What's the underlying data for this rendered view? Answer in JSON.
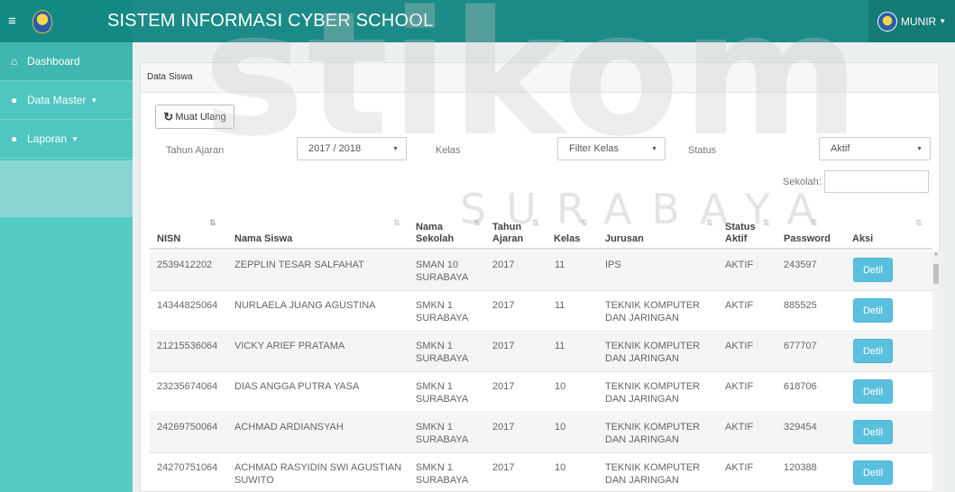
{
  "header": {
    "menu_icon": "hamburger-icon",
    "logo_icon": "crest-logo-icon",
    "title": "SISTEM INFORMASI CYBER SCHOOL",
    "user": "MUNIR"
  },
  "sidebar": {
    "items": [
      {
        "label": "Dashboard",
        "icon": "home-icon"
      },
      {
        "label": "Data Master",
        "icon": "users-icon"
      },
      {
        "label": "Laporan",
        "icon": "users-icon"
      }
    ]
  },
  "watermark": {
    "big": "stikom",
    "small": "SURABAYA"
  },
  "panel": {
    "heading": "Data Siswa",
    "reload_label": "Muat Ulang",
    "filters": {
      "tahun_label": "Tahun Ajaran",
      "tahun_value": "2017 / 2018",
      "kelas_label": "Kelas",
      "kelas_value": "Filter Kelas",
      "status_label": "Status",
      "status_value": "Aktif",
      "sekolah_label": "Sekolah:"
    }
  },
  "table": {
    "headers": {
      "nisn": "NISN",
      "nama": "Nama Siswa",
      "sekolah": "Nama Sekolah",
      "tahun": "Tahun Ajaran",
      "kelas": "Kelas",
      "jurusan": "Jurusan",
      "status": "Status Aktif",
      "password": "Password",
      "aksi": "Aksi"
    },
    "detail_label": "Detil",
    "rows": [
      {
        "nisn": "2539412202",
        "nama": "ZEPPLIN TESAR SALFAHAT",
        "sekolah": "SMAN 10 SURABAYA",
        "tahun": "2017",
        "kelas": "11",
        "jurusan": "IPS",
        "status": "AKTIF",
        "password": "243597"
      },
      {
        "nisn": "14344825064",
        "nama": "NURLAELA JUANG AGUSTINA",
        "sekolah": "SMKN 1 SURABAYA",
        "tahun": "2017",
        "kelas": "11",
        "jurusan": "TEKNIK KOMPUTER DAN JARINGAN",
        "status": "AKTIF",
        "password": "885525"
      },
      {
        "nisn": "21215536064",
        "nama": "VICKY ARIEF PRATAMA",
        "sekolah": "SMKN 1 SURABAYA",
        "tahun": "2017",
        "kelas": "11",
        "jurusan": "TEKNIK KOMPUTER DAN JARINGAN",
        "status": "AKTIF",
        "password": "677707"
      },
      {
        "nisn": "23235674064",
        "nama": "DIAS ANGGA PUTRA YASA",
        "sekolah": "SMKN 1 SURABAYA",
        "tahun": "2017",
        "kelas": "10",
        "jurusan": "TEKNIK KOMPUTER DAN JARINGAN",
        "status": "AKTIF",
        "password": "618706"
      },
      {
        "nisn": "24269750064",
        "nama": "ACHMAD ARDIANSYAH",
        "sekolah": "SMKN 1 SURABAYA",
        "tahun": "2017",
        "kelas": "10",
        "jurusan": "TEKNIK KOMPUTER DAN JARINGAN",
        "status": "AKTIF",
        "password": "329454"
      },
      {
        "nisn": "24270751064",
        "nama": "ACHMAD RASYIDIN SWI AGUSTIAN SUWITO",
        "sekolah": "SMKN 1 SURABAYA",
        "tahun": "2017",
        "kelas": "10",
        "jurusan": "TEKNIK KOMPUTER DAN JARINGAN",
        "status": "AKTIF",
        "password": "120388"
      }
    ]
  }
}
